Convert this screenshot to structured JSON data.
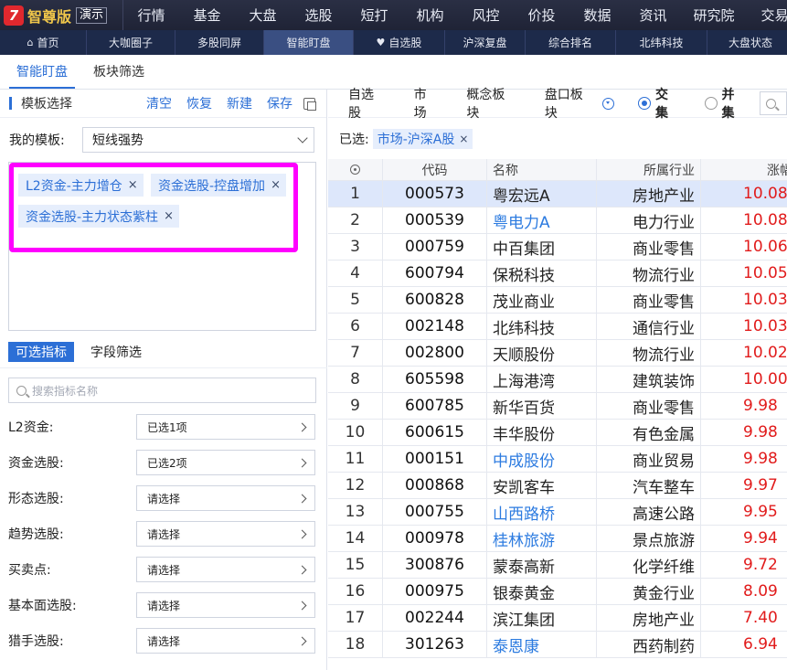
{
  "app": {
    "logo_text": "智尊版",
    "demo_badge": "演示"
  },
  "top_menu": [
    "行情",
    "基金",
    "大盘",
    "选股",
    "短打",
    "机构",
    "风控",
    "价投",
    "数据",
    "资讯",
    "研究院",
    "交易"
  ],
  "nav_tabs": [
    {
      "label": "首页",
      "icon": "home-icon",
      "active": false
    },
    {
      "label": "大咖圈子",
      "active": false
    },
    {
      "label": "多股同屏",
      "active": false
    },
    {
      "label": "智能盯盘",
      "active": true
    },
    {
      "label": "自选股",
      "icon": "heart-icon",
      "active": false
    },
    {
      "label": "沪深复盘",
      "active": false
    },
    {
      "label": "综合排名",
      "active": false
    },
    {
      "label": "北纬科技",
      "active": false
    },
    {
      "label": "大盘状态",
      "active": false
    }
  ],
  "sub_tabs": [
    {
      "label": "智能盯盘",
      "active": true
    },
    {
      "label": "板块筛选",
      "active": false
    }
  ],
  "template_panel": {
    "title": "模板选择",
    "actions": [
      "清空",
      "恢复",
      "新建",
      "保存"
    ],
    "my_template_label": "我的模板:",
    "my_template_value": "短线强势",
    "conditions": [
      "L2资金-主力增仓",
      "资金选股-控盘增加",
      "资金选股-主力状态紫柱"
    ],
    "chip_close": "×"
  },
  "indicator_panel": {
    "tabs": [
      {
        "label": "可选指标",
        "active": true
      },
      {
        "label": "字段筛选",
        "active": false
      }
    ],
    "search_placeholder": "搜索指标名称",
    "rows": [
      {
        "label": "L2资金:",
        "value": "已选1项"
      },
      {
        "label": "资金选股:",
        "value": "已选2项"
      },
      {
        "label": "形态选股:",
        "value": "请选择"
      },
      {
        "label": "趋势选股:",
        "value": "请选择"
      },
      {
        "label": "买卖点:",
        "value": "请选择"
      },
      {
        "label": "基本面选股:",
        "value": "请选择"
      },
      {
        "label": "猎手选股:",
        "value": "请选择"
      }
    ]
  },
  "filter_bar": {
    "items": [
      "自选股",
      "市场",
      "概念板块"
    ],
    "last_item": "盘口板块",
    "radio_intersect": "交集",
    "radio_union": "并集",
    "mode": "交集"
  },
  "selected": {
    "label": "已选:",
    "chip": "市场-沪深A股",
    "chip_close": "×"
  },
  "table": {
    "headers": [
      "代码",
      "名称",
      "所属行业",
      "涨幅"
    ],
    "rows": [
      {
        "idx": "1",
        "code": "000573",
        "name": "粤宏远A",
        "industry": "房地产业",
        "change": "10.08",
        "link": false
      },
      {
        "idx": "2",
        "code": "000539",
        "name": "粤电力A",
        "industry": "电力行业",
        "change": "10.08",
        "link": true
      },
      {
        "idx": "3",
        "code": "000759",
        "name": "中百集团",
        "industry": "商业零售",
        "change": "10.06",
        "link": false
      },
      {
        "idx": "4",
        "code": "600794",
        "name": "保税科技",
        "industry": "物流行业",
        "change": "10.05",
        "link": false
      },
      {
        "idx": "5",
        "code": "600828",
        "name": "茂业商业",
        "industry": "商业零售",
        "change": "10.03",
        "link": false
      },
      {
        "idx": "6",
        "code": "002148",
        "name": "北纬科技",
        "industry": "通信行业",
        "change": "10.03",
        "link": false
      },
      {
        "idx": "7",
        "code": "002800",
        "name": "天顺股份",
        "industry": "物流行业",
        "change": "10.02",
        "link": false
      },
      {
        "idx": "8",
        "code": "605598",
        "name": "上海港湾",
        "industry": "建筑装饰",
        "change": "10.00",
        "link": false
      },
      {
        "idx": "9",
        "code": "600785",
        "name": "新华百货",
        "industry": "商业零售",
        "change": "9.98",
        "link": false
      },
      {
        "idx": "10",
        "code": "600615",
        "name": "丰华股份",
        "industry": "有色金属",
        "change": "9.98",
        "link": false
      },
      {
        "idx": "11",
        "code": "000151",
        "name": "中成股份",
        "industry": "商业贸易",
        "change": "9.98",
        "link": true
      },
      {
        "idx": "12",
        "code": "000868",
        "name": "安凯客车",
        "industry": "汽车整车",
        "change": "9.97",
        "link": false
      },
      {
        "idx": "13",
        "code": "000755",
        "name": "山西路桥",
        "industry": "高速公路",
        "change": "9.95",
        "link": true
      },
      {
        "idx": "14",
        "code": "000978",
        "name": "桂林旅游",
        "industry": "景点旅游",
        "change": "9.94",
        "link": true
      },
      {
        "idx": "15",
        "code": "300876",
        "name": "蒙泰高新",
        "industry": "化学纤维",
        "change": "9.72",
        "link": false
      },
      {
        "idx": "16",
        "code": "000975",
        "name": "银泰黄金",
        "industry": "黄金行业",
        "change": "8.09",
        "link": false
      },
      {
        "idx": "17",
        "code": "002244",
        "name": "滨江集团",
        "industry": "房地产业",
        "change": "7.40",
        "link": false
      },
      {
        "idx": "18",
        "code": "301263",
        "name": "泰恩康",
        "industry": "西药制药",
        "change": "6.94",
        "link": true
      }
    ]
  },
  "colors": {
    "accent": "#2c6fd6",
    "rise": "#e11b1b",
    "highlight_border": "#ff00ff",
    "topbar": "#1f2336",
    "logo_gold": "#f0c64a"
  }
}
